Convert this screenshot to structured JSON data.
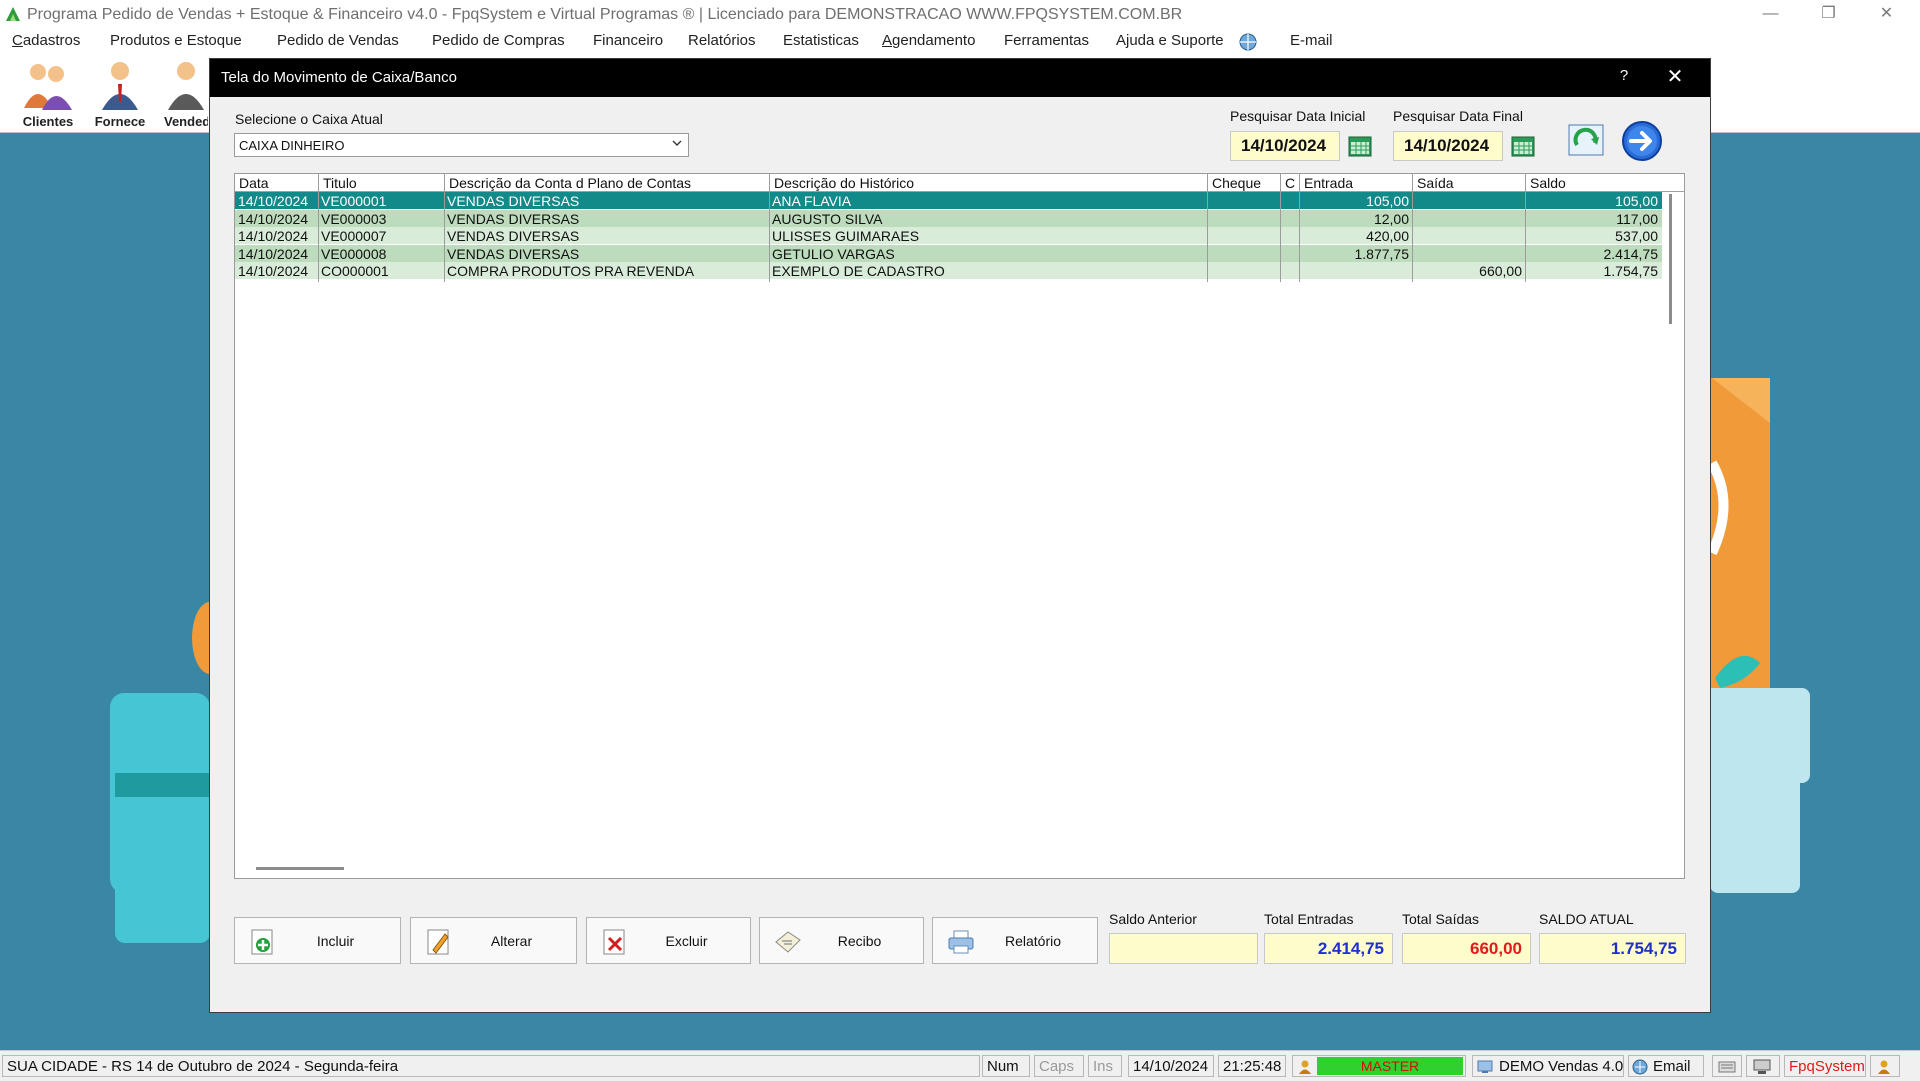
{
  "app": {
    "title": "Programa Pedido de Vendas + Estoque & Financeiro v4.0 - FpqSystem e Virtual Programas ® | Licenciado para  DEMONSTRACAO WWW.FPQSYSTEM.COM.BR"
  },
  "menu": [
    "Cadastros",
    "Produtos e Estoque",
    "Pedido de Vendas",
    "Pedido de Compras",
    "Financeiro",
    "Relatórios",
    "Estatisticas",
    "Agendamento",
    "Ferramentas",
    "Ajuda e Suporte",
    "E-mail"
  ],
  "toolbar": [
    "Clientes",
    "Fornece",
    "Vended"
  ],
  "dialog": {
    "title": "Tela do Movimento de Caixa/Banco",
    "help": "?",
    "close": "✕",
    "caixa_label": "Selecione o Caixa Atual",
    "caixa_value": "CAIXA DINHEIRO",
    "data_inicial_label": "Pesquisar Data Inicial",
    "data_inicial": "14/10/2024",
    "data_final_label": "Pesquisar Data Final",
    "data_final": "14/10/2024"
  },
  "grid": {
    "columns": [
      "Data",
      "Titulo",
      "Descrição da Conta d Plano de Contas",
      "Descrição do Histórico",
      "Cheque",
      "C",
      "Entrada",
      "Saída",
      "Saldo"
    ],
    "rows": [
      {
        "data": "14/10/2024",
        "titulo": "VE000001",
        "conta": "VENDAS DIVERSAS",
        "historico": "ANA FLAVIA",
        "cheque": "",
        "c": "",
        "entrada": "105,00",
        "saida": "",
        "saldo": "105,00"
      },
      {
        "data": "14/10/2024",
        "titulo": "VE000003",
        "conta": "VENDAS DIVERSAS",
        "historico": "AUGUSTO SILVA",
        "cheque": "",
        "c": "",
        "entrada": "12,00",
        "saida": "",
        "saldo": "117,00"
      },
      {
        "data": "14/10/2024",
        "titulo": "VE000007",
        "conta": "VENDAS DIVERSAS",
        "historico": "ULISSES GUIMARAES",
        "cheque": "",
        "c": "",
        "entrada": "420,00",
        "saida": "",
        "saldo": "537,00"
      },
      {
        "data": "14/10/2024",
        "titulo": "VE000008",
        "conta": "VENDAS DIVERSAS",
        "historico": "GETULIO VARGAS",
        "cheque": "",
        "c": "",
        "entrada": "1.877,75",
        "saida": "",
        "saldo": "2.414,75"
      },
      {
        "data": "14/10/2024",
        "titulo": "CO000001",
        "conta": "COMPRA PRODUTOS PRA REVENDA",
        "historico": "EXEMPLO DE CADASTRO",
        "cheque": "",
        "c": "",
        "entrada": "",
        "saida": "660,00",
        "saldo": "1.754,75"
      }
    ]
  },
  "buttons": {
    "incluir": "Incluir",
    "alterar": "Alterar",
    "excluir": "Excluir",
    "recibo": "Recibo",
    "relatorio": "Relatório"
  },
  "totals": {
    "saldo_anterior_label": "Saldo Anterior",
    "saldo_anterior": "",
    "total_entradas_label": "Total Entradas",
    "total_entradas": "2.414,75",
    "total_saidas_label": "Total Saídas",
    "total_saidas": "660,00",
    "saldo_atual_label": "SALDO ATUAL",
    "saldo_atual": "1.754,75"
  },
  "statusbar": {
    "cidade": "SUA CIDADE - RS 14 de Outubro de 2024 - Segunda-feira",
    "num": "Num",
    "caps": "Caps",
    "ins": "Ins",
    "date": "14/10/2024",
    "time": "21:25:48",
    "user": "MASTER",
    "version": "DEMO Vendas 4.0",
    "email": "Email",
    "brand": "FpqSystem"
  },
  "colors": {
    "selected_row": "#138a8a",
    "row_alt_green": "#bddbbd",
    "row_light_green": "#d9ecd9",
    "entradas": "#1e2fcf",
    "saidas": "#e11a1a",
    "desktop": "#3a87a5"
  }
}
